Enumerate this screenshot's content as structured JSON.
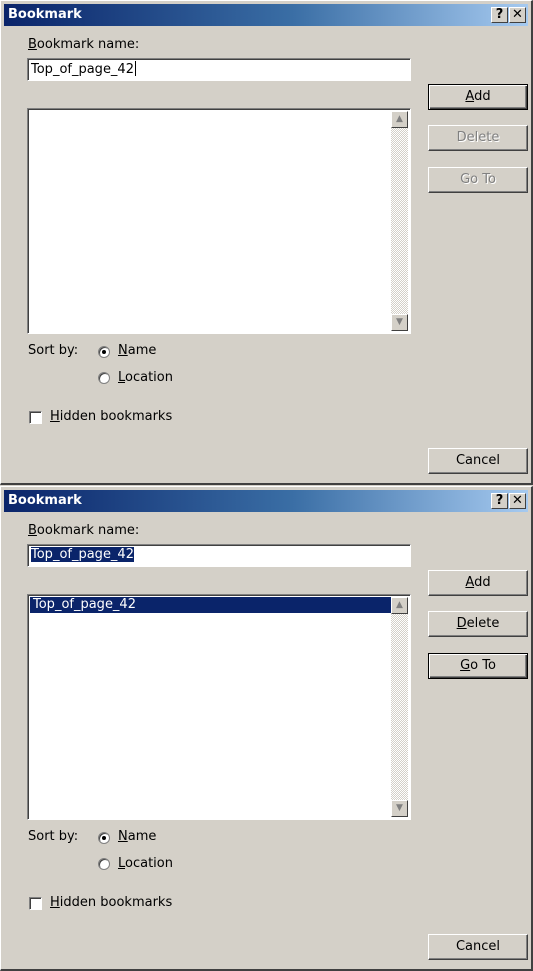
{
  "dialog_before": {
    "title": "Bookmark",
    "help_glyph": "?",
    "close_glyph": "✕",
    "name_label_key": "B",
    "name_label_rest": "ookmark name:",
    "name_value": "Top_of_page_42",
    "list_items": [],
    "add_key": "A",
    "add_rest": "dd",
    "delete_label": "Delete",
    "goto_label": "Go To",
    "sort_by_label": "Sort by:",
    "sort_name_key": "N",
    "sort_name_rest": "ame",
    "sort_location_key": "L",
    "sort_location_rest": "ocation",
    "sort_selected": "Name",
    "hidden_key": "H",
    "hidden_rest": "idden bookmarks",
    "hidden_checked": false,
    "cancel_label": "Cancel"
  },
  "dialog_after": {
    "title": "Bookmark",
    "help_glyph": "?",
    "close_glyph": "✕",
    "name_label_key": "B",
    "name_label_rest": "ookmark name:",
    "name_value": "Top_of_page_42",
    "list_items": [
      "Top_of_page_42"
    ],
    "add_key": "A",
    "add_rest": "dd",
    "delete_key": "D",
    "delete_rest": "elete",
    "goto_key": "G",
    "goto_rest": "o To",
    "sort_by_label": "Sort by:",
    "sort_name_key": "N",
    "sort_name_rest": "ame",
    "sort_location_key": "L",
    "sort_location_rest": "ocation",
    "sort_selected": "Name",
    "hidden_key": "H",
    "hidden_rest": "idden bookmarks",
    "hidden_checked": false,
    "cancel_label": "Cancel"
  },
  "colors": {
    "titlebar_start": "#0a246a",
    "titlebar_end": "#a6caf0",
    "dialog_bg": "#d4d0c8",
    "selection": "#0a246a"
  },
  "icons": [
    "help-icon",
    "close-icon",
    "scroll-up-arrow-icon",
    "scroll-down-arrow-icon"
  ]
}
